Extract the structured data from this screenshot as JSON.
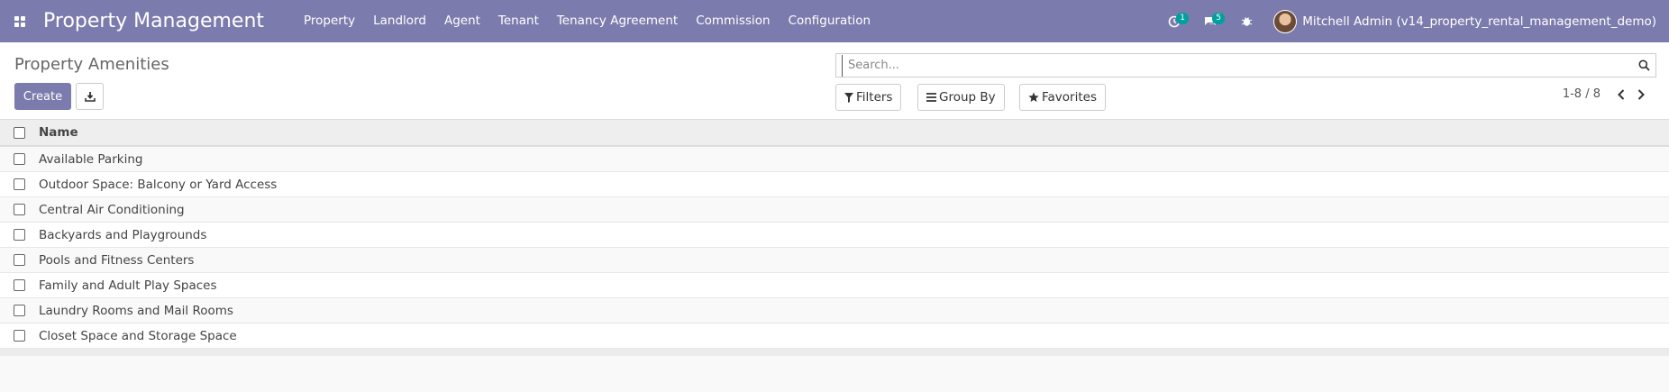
{
  "navbar": {
    "brand": "Property Management",
    "menu": [
      "Property",
      "Landlord",
      "Agent",
      "Tenant",
      "Tenancy Agreement",
      "Commission",
      "Configuration"
    ],
    "activity_count": "1",
    "messages_count": "5",
    "user_name": "Mitchell Admin (v14_property_rental_management_demo)",
    "colors": {
      "bar": "#7c7bad",
      "badge": "#00a09d"
    }
  },
  "control_panel": {
    "breadcrumb": "Property Amenities",
    "create_label": "Create",
    "search_placeholder": "Search...",
    "filters_label": "Filters",
    "group_by_label": "Group By",
    "favorites_label": "Favorites",
    "pager_value": "1-8 / 8"
  },
  "list": {
    "column_name": "Name",
    "rows": [
      "Available Parking",
      "Outdoor Space: Balcony or Yard Access",
      "Central Air Conditioning",
      "Backyards and Playgrounds",
      "Pools and Fitness Centers",
      "Family and Adult Play Spaces",
      "Laundry Rooms and Mail Rooms",
      "Closet Space and Storage Space"
    ]
  }
}
